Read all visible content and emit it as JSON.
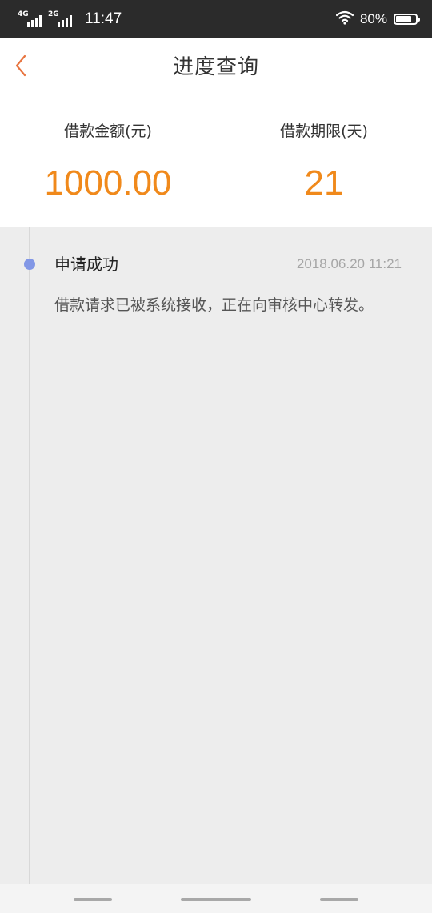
{
  "status_bar": {
    "network1_label": "4G",
    "network2_label": "2G",
    "time": "11:47",
    "battery_percent": "80%",
    "battery_level": 0.8
  },
  "header": {
    "title": "进度查询",
    "back_icon": "chevron-left-icon",
    "back_icon_color": "#e8743f"
  },
  "summary": {
    "amount_label": "借款金额(元)",
    "amount_value": "1000.00",
    "term_label": "借款期限(天)",
    "term_value": "21",
    "value_color": "#f0891b"
  },
  "timeline": {
    "events": [
      {
        "title": "申请成功",
        "time": "2018.06.20 11:21",
        "description": "借款请求已被系统接收，正在向审核中心转发。",
        "dot_color": "#8297e6"
      }
    ]
  }
}
